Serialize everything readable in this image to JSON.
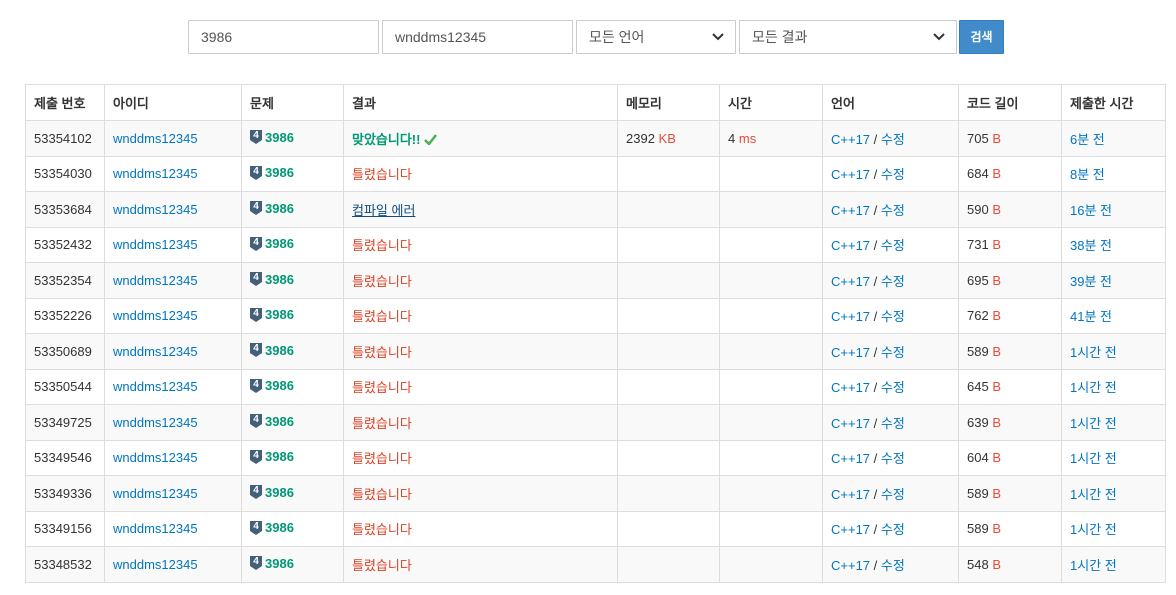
{
  "filters": {
    "problem_id": "3986",
    "user_id": "wnddms12345",
    "language": "모든 언어",
    "result": "모든 결과",
    "search_label": "검색"
  },
  "table": {
    "headers": [
      "제출 번호",
      "아이디",
      "문제",
      "결과",
      "메모리",
      "시간",
      "언어",
      "코드 길이",
      "제출한 시간"
    ],
    "separator": "/",
    "rows": [
      {
        "id": "53354102",
        "user": "wnddms12345",
        "tier": "4",
        "problem": "3986",
        "result": "맞았습니다!!",
        "status": "ac",
        "memory": "2392",
        "memory_unit": "KB",
        "time": "4",
        "time_unit": "ms",
        "lang": "C++17",
        "edit": "수정",
        "length": "705",
        "length_unit": "B",
        "submitted": "6분 전"
      },
      {
        "id": "53354030",
        "user": "wnddms12345",
        "tier": "4",
        "problem": "3986",
        "result": "틀렸습니다",
        "status": "wa",
        "memory": "",
        "memory_unit": "",
        "time": "",
        "time_unit": "",
        "lang": "C++17",
        "edit": "수정",
        "length": "684",
        "length_unit": "B",
        "submitted": "8분 전"
      },
      {
        "id": "53353684",
        "user": "wnddms12345",
        "tier": "4",
        "problem": "3986",
        "result": "컴파일 에러",
        "status": "ce",
        "memory": "",
        "memory_unit": "",
        "time": "",
        "time_unit": "",
        "lang": "C++17",
        "edit": "수정",
        "length": "590",
        "length_unit": "B",
        "submitted": "16분 전"
      },
      {
        "id": "53352432",
        "user": "wnddms12345",
        "tier": "4",
        "problem": "3986",
        "result": "틀렸습니다",
        "status": "wa",
        "memory": "",
        "memory_unit": "",
        "time": "",
        "time_unit": "",
        "lang": "C++17",
        "edit": "수정",
        "length": "731",
        "length_unit": "B",
        "submitted": "38분 전"
      },
      {
        "id": "53352354",
        "user": "wnddms12345",
        "tier": "4",
        "problem": "3986",
        "result": "틀렸습니다",
        "status": "wa",
        "memory": "",
        "memory_unit": "",
        "time": "",
        "time_unit": "",
        "lang": "C++17",
        "edit": "수정",
        "length": "695",
        "length_unit": "B",
        "submitted": "39분 전"
      },
      {
        "id": "53352226",
        "user": "wnddms12345",
        "tier": "4",
        "problem": "3986",
        "result": "틀렸습니다",
        "status": "wa",
        "memory": "",
        "memory_unit": "",
        "time": "",
        "time_unit": "",
        "lang": "C++17",
        "edit": "수정",
        "length": "762",
        "length_unit": "B",
        "submitted": "41분 전"
      },
      {
        "id": "53350689",
        "user": "wnddms12345",
        "tier": "4",
        "problem": "3986",
        "result": "틀렸습니다",
        "status": "wa",
        "memory": "",
        "memory_unit": "",
        "time": "",
        "time_unit": "",
        "lang": "C++17",
        "edit": "수정",
        "length": "589",
        "length_unit": "B",
        "submitted": "1시간 전"
      },
      {
        "id": "53350544",
        "user": "wnddms12345",
        "tier": "4",
        "problem": "3986",
        "result": "틀렸습니다",
        "status": "wa",
        "memory": "",
        "memory_unit": "",
        "time": "",
        "time_unit": "",
        "lang": "C++17",
        "edit": "수정",
        "length": "645",
        "length_unit": "B",
        "submitted": "1시간 전"
      },
      {
        "id": "53349725",
        "user": "wnddms12345",
        "tier": "4",
        "problem": "3986",
        "result": "틀렸습니다",
        "status": "wa",
        "memory": "",
        "memory_unit": "",
        "time": "",
        "time_unit": "",
        "lang": "C++17",
        "edit": "수정",
        "length": "639",
        "length_unit": "B",
        "submitted": "1시간 전"
      },
      {
        "id": "53349546",
        "user": "wnddms12345",
        "tier": "4",
        "problem": "3986",
        "result": "틀렸습니다",
        "status": "wa",
        "memory": "",
        "memory_unit": "",
        "time": "",
        "time_unit": "",
        "lang": "C++17",
        "edit": "수정",
        "length": "604",
        "length_unit": "B",
        "submitted": "1시간 전"
      },
      {
        "id": "53349336",
        "user": "wnddms12345",
        "tier": "4",
        "problem": "3986",
        "result": "틀렸습니다",
        "status": "wa",
        "memory": "",
        "memory_unit": "",
        "time": "",
        "time_unit": "",
        "lang": "C++17",
        "edit": "수정",
        "length": "589",
        "length_unit": "B",
        "submitted": "1시간 전"
      },
      {
        "id": "53349156",
        "user": "wnddms12345",
        "tier": "4",
        "problem": "3986",
        "result": "틀렸습니다",
        "status": "wa",
        "memory": "",
        "memory_unit": "",
        "time": "",
        "time_unit": "",
        "lang": "C++17",
        "edit": "수정",
        "length": "589",
        "length_unit": "B",
        "submitted": "1시간 전"
      },
      {
        "id": "53348532",
        "user": "wnddms12345",
        "tier": "4",
        "problem": "3986",
        "result": "틀렸습니다",
        "status": "wa",
        "memory": "",
        "memory_unit": "",
        "time": "",
        "time_unit": "",
        "lang": "C++17",
        "edit": "수정",
        "length": "548",
        "length_unit": "B",
        "submitted": "1시간 전"
      }
    ]
  },
  "icons": {
    "tier": "tier-badge-icon",
    "check": "check-icon",
    "caret": "chevron-down-icon"
  },
  "colors": {
    "accepted": "#009874",
    "wrong": "#dd4124",
    "compile_error": "#0f4c81",
    "link": "#0076c0",
    "unit": "#e74c3c",
    "tier_badge": "#435f7a",
    "button": "#428bca"
  }
}
